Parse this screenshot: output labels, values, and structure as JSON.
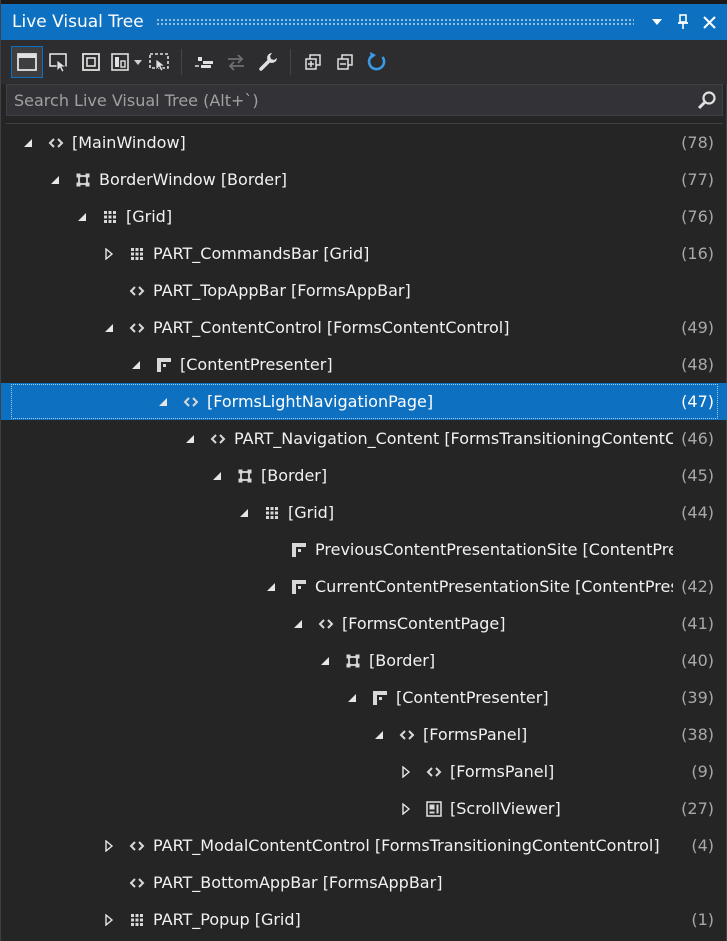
{
  "window": {
    "title": "Live Visual Tree"
  },
  "colors": {
    "accent": "#0e70c0",
    "background": "#252526",
    "text": "#f1f1f1",
    "count_text": "#a8a8a8"
  },
  "toolbar": {
    "buttons": [
      {
        "icon": "display-adorners-icon",
        "active": true
      },
      {
        "icon": "select-element-icon",
        "active": false
      },
      {
        "icon": "layout-adorners-icon",
        "active": false
      },
      {
        "icon": "track-focus-icon",
        "active": false
      },
      {
        "icon": "preview-selection-icon",
        "active": false
      },
      {
        "icon": "show-just-my-xaml-icon",
        "active": false
      },
      {
        "icon": "track-selection-icon",
        "active": false
      },
      {
        "icon": "properties-wrench-icon",
        "active": false
      },
      {
        "icon": "expand-all-icon",
        "active": false
      },
      {
        "icon": "collapse-all-icon",
        "active": false
      },
      {
        "icon": "refresh-icon",
        "active": false
      }
    ]
  },
  "search": {
    "placeholder": "Search Live Visual Tree (Alt+`)",
    "value": ""
  },
  "tree": {
    "rows": [
      {
        "depth": 0,
        "expander": "expanded",
        "icon": "angle-brackets",
        "label": "[MainWindow]",
        "count": "(78)"
      },
      {
        "depth": 1,
        "expander": "expanded",
        "icon": "border",
        "label": "BorderWindow [Border]",
        "count": "(77)"
      },
      {
        "depth": 2,
        "expander": "expanded",
        "icon": "grid",
        "label": "[Grid]",
        "count": "(76)"
      },
      {
        "depth": 3,
        "expander": "collapsed",
        "icon": "grid",
        "label": "PART_CommandsBar [Grid]",
        "count": "(16)"
      },
      {
        "depth": 3,
        "expander": "none",
        "icon": "angle-brackets",
        "label": "PART_TopAppBar [FormsAppBar]",
        "count": ""
      },
      {
        "depth": 3,
        "expander": "expanded",
        "icon": "angle-brackets",
        "label": "PART_ContentControl [FormsContentControl]",
        "count": "(49)"
      },
      {
        "depth": 4,
        "expander": "expanded",
        "icon": "content-presenter",
        "label": "[ContentPresenter]",
        "count": "(48)"
      },
      {
        "depth": 5,
        "expander": "expanded",
        "icon": "angle-brackets",
        "label": "[FormsLightNavigationPage]",
        "count": "(47)",
        "selected": true
      },
      {
        "depth": 6,
        "expander": "expanded",
        "icon": "angle-brackets",
        "label": "PART_Navigation_Content [FormsTransitioningContentC",
        "count": "(46)"
      },
      {
        "depth": 7,
        "expander": "expanded",
        "icon": "border",
        "label": "[Border]",
        "count": "(45)"
      },
      {
        "depth": 8,
        "expander": "expanded",
        "icon": "grid",
        "label": "[Grid]",
        "count": "(44)"
      },
      {
        "depth": 9,
        "expander": "none",
        "icon": "content-presenter",
        "label": "PreviousContentPresentationSite [ContentPresenter]",
        "count": ""
      },
      {
        "depth": 9,
        "expander": "expanded",
        "icon": "content-presenter",
        "label": "CurrentContentPresentationSite [ContentPresenter]",
        "count": "(42)"
      },
      {
        "depth": 10,
        "expander": "expanded",
        "icon": "angle-brackets",
        "label": "[FormsContentPage]",
        "count": "(41)"
      },
      {
        "depth": 11,
        "expander": "expanded",
        "icon": "border",
        "label": "[Border]",
        "count": "(40)"
      },
      {
        "depth": 12,
        "expander": "expanded",
        "icon": "content-presenter",
        "label": "[ContentPresenter]",
        "count": "(39)"
      },
      {
        "depth": 13,
        "expander": "expanded",
        "icon": "angle-brackets",
        "label": "[FormsPanel]",
        "count": "(38)"
      },
      {
        "depth": 14,
        "expander": "collapsed",
        "icon": "angle-brackets",
        "label": "[FormsPanel]",
        "count": "(9)"
      },
      {
        "depth": 14,
        "expander": "collapsed",
        "icon": "scroll-viewer",
        "label": "[ScrollViewer]",
        "count": "(27)"
      },
      {
        "depth": 3,
        "expander": "collapsed",
        "icon": "angle-brackets",
        "label": "PART_ModalContentControl [FormsTransitioningContentControl]",
        "count": "(4)"
      },
      {
        "depth": 3,
        "expander": "none",
        "icon": "angle-brackets",
        "label": "PART_BottomAppBar [FormsAppBar]",
        "count": ""
      },
      {
        "depth": 3,
        "expander": "collapsed",
        "icon": "grid",
        "label": "PART_Popup [Grid]",
        "count": "(1)"
      }
    ]
  }
}
